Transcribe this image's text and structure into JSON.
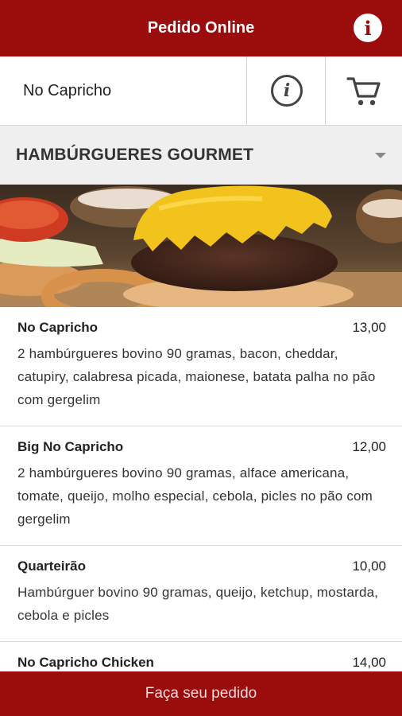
{
  "header": {
    "title": "Pedido Online",
    "info_icon": "info-icon"
  },
  "store": {
    "name": "No Capricho",
    "info_icon": "info-icon",
    "cart_icon": "cart-icon"
  },
  "category": {
    "label": "HAMBÚRGUERES GOURMET",
    "caret_icon": "chevron-down-icon"
  },
  "banner": {
    "image": "burger-photo"
  },
  "items": [
    {
      "name": "No Capricho",
      "price": "13,00",
      "description": "2 hambúrgueres bovino 90 gramas, bacon, cheddar, catupiry, calabresa picada, maionese, batata palha no pão com gergelim"
    },
    {
      "name": "Big No Capricho",
      "price": "12,00",
      "description": "2 hambúrgueres bovino 90 gramas, alface americana, tomate, queijo, molho especial, cebola, picles no pão com gergelim"
    },
    {
      "name": "Quarteirão",
      "price": "10,00",
      "description": "Hambúrguer bovino 90 gramas, queijo, ketchup, mostarda, cebola e picles"
    },
    {
      "name": "No Capricho Chicken",
      "price": "14,00",
      "description": ""
    }
  ],
  "footer": {
    "order_label": "Faça seu pedido"
  },
  "colors": {
    "brand": "#9b0c0c",
    "category_bg": "#efefef"
  }
}
